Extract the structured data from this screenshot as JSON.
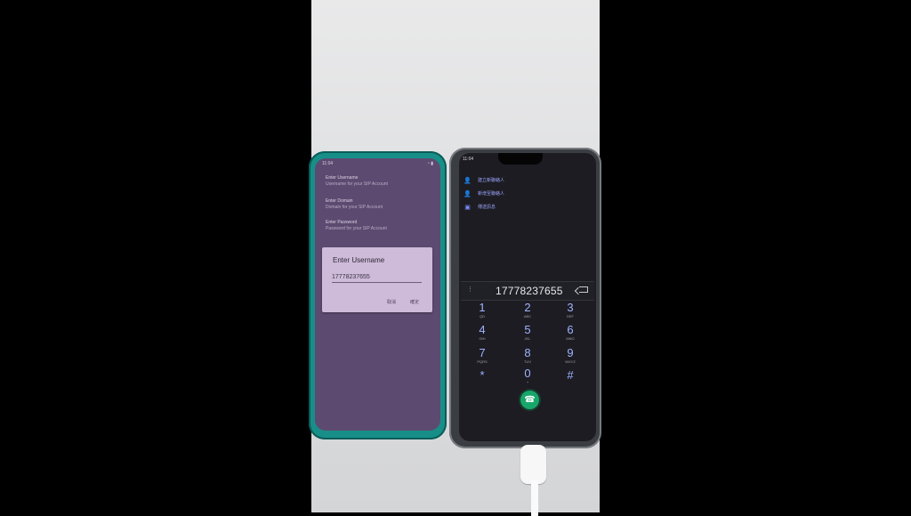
{
  "left_phone": {
    "status_time": "11:04",
    "settings": [
      {
        "title": "Enter Username",
        "subtitle": "Username for your SIP Account"
      },
      {
        "title": "Enter Domain",
        "subtitle": "Domain for your SIP Account"
      },
      {
        "title": "Enter Password",
        "subtitle": "Password for your SIP Account"
      }
    ],
    "dialog": {
      "title": "Enter Username",
      "value": "17778237655",
      "cancel_label": "取消",
      "confirm_label": "確定"
    }
  },
  "right_phone": {
    "status_time": "11:04",
    "quick_actions": [
      {
        "icon": "add-contact-icon",
        "label": "建立新聯絡人"
      },
      {
        "icon": "add-contact-icon",
        "label": "新增至聯絡人"
      },
      {
        "icon": "message-icon",
        "label": "傳送訊息"
      }
    ],
    "number": "17778237655",
    "keypad": [
      {
        "num": "1",
        "letters": "QD"
      },
      {
        "num": "2",
        "letters": "ABC"
      },
      {
        "num": "3",
        "letters": "DEF"
      },
      {
        "num": "4",
        "letters": "GHI"
      },
      {
        "num": "5",
        "letters": "JKL"
      },
      {
        "num": "6",
        "letters": "MNO"
      },
      {
        "num": "7",
        "letters": "PQRS"
      },
      {
        "num": "8",
        "letters": "TUV"
      },
      {
        "num": "9",
        "letters": "WXYZ"
      },
      {
        "num": "*",
        "letters": ""
      },
      {
        "num": "0",
        "letters": "+"
      },
      {
        "num": "#",
        "letters": ""
      }
    ],
    "call_icon": "phone-icon"
  },
  "colors": {
    "background": "#000000",
    "left_screen": "#5d4a70",
    "dialog": "#cdbbd9",
    "right_screen": "#1d1c22",
    "call_button": "#17a76a"
  }
}
